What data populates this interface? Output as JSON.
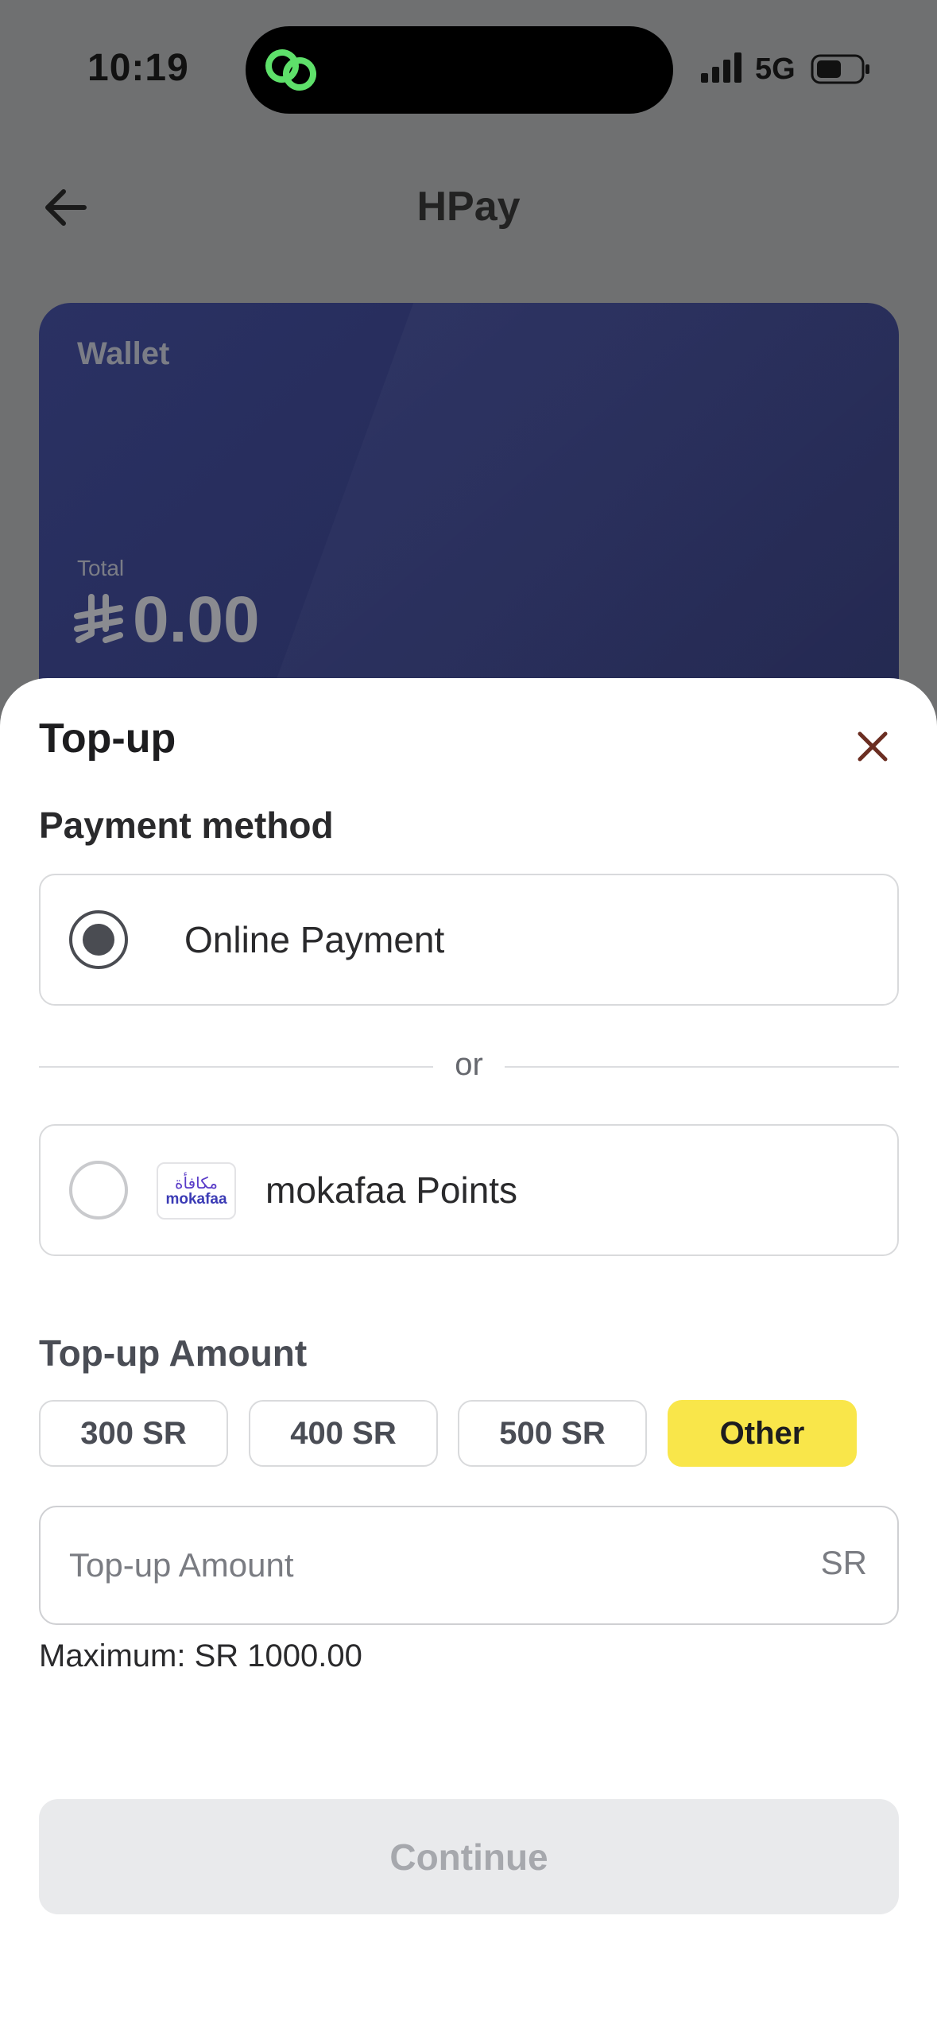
{
  "status_bar": {
    "time": "10:19",
    "network": "5G"
  },
  "nav": {
    "title": "HPay",
    "back_icon": "arrow-left-icon"
  },
  "wallet": {
    "label": "Wallet",
    "total_label": "Total",
    "total_value": "0.00",
    "currency_icon": "saudi-riyal-icon"
  },
  "sheet": {
    "title": "Top-up",
    "close_icon": "close-icon",
    "payment_method_label": "Payment method",
    "options": [
      {
        "label": "Online Payment",
        "selected": true
      },
      {
        "label": "mokafaa Points",
        "selected": false,
        "logo_ar": "مكافأة",
        "logo_en": "mokafaa"
      }
    ],
    "divider_text": "or",
    "amount_label": "Top-up Amount",
    "chips": [
      "300 SR",
      "400 SR",
      "500 SR",
      "Other"
    ],
    "selected_chip": "Other",
    "amount_placeholder": "Top-up Amount",
    "amount_value": "",
    "currency_suffix": "SR",
    "maximum_text": "Maximum: SR 1000.00",
    "continue_label": "Continue"
  },
  "colors": {
    "accent_yellow": "#f9e64a",
    "card_bg": "#2a3163",
    "overlay": "#6f7071",
    "disabled_button": "#e9eaec"
  }
}
